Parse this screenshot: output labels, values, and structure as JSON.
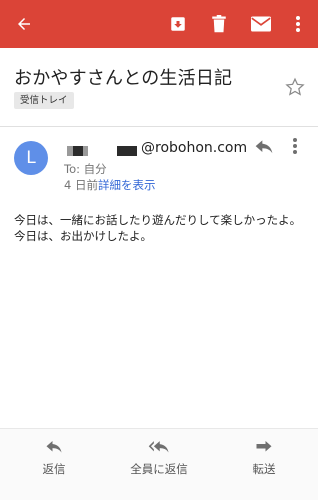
{
  "toolbar": {
    "back_icon": "arrow-back-icon",
    "archive_icon": "archive-icon",
    "delete_icon": "trash-icon",
    "mark_unread_icon": "mail-icon",
    "more_icon": "more-vert-icon",
    "color": "#db4437"
  },
  "message": {
    "subject": "おかやすさんとの生活日記",
    "label": "受信トレイ",
    "avatar_letter": "L",
    "avatar_color": "#5f8fe8",
    "sender_domain": "@robohon.com",
    "to_prefix": "To: ",
    "to_name": "自分",
    "date": "4 日前",
    "details_link": "詳細を表示",
    "body_lines": [
      "今日は、一緒にお話したり遊んだりして楽しかったよ。",
      "今日は、お出かけしたよ。"
    ]
  },
  "actions": {
    "reply": "返信",
    "reply_all": "全員に返信",
    "forward": "転送"
  }
}
